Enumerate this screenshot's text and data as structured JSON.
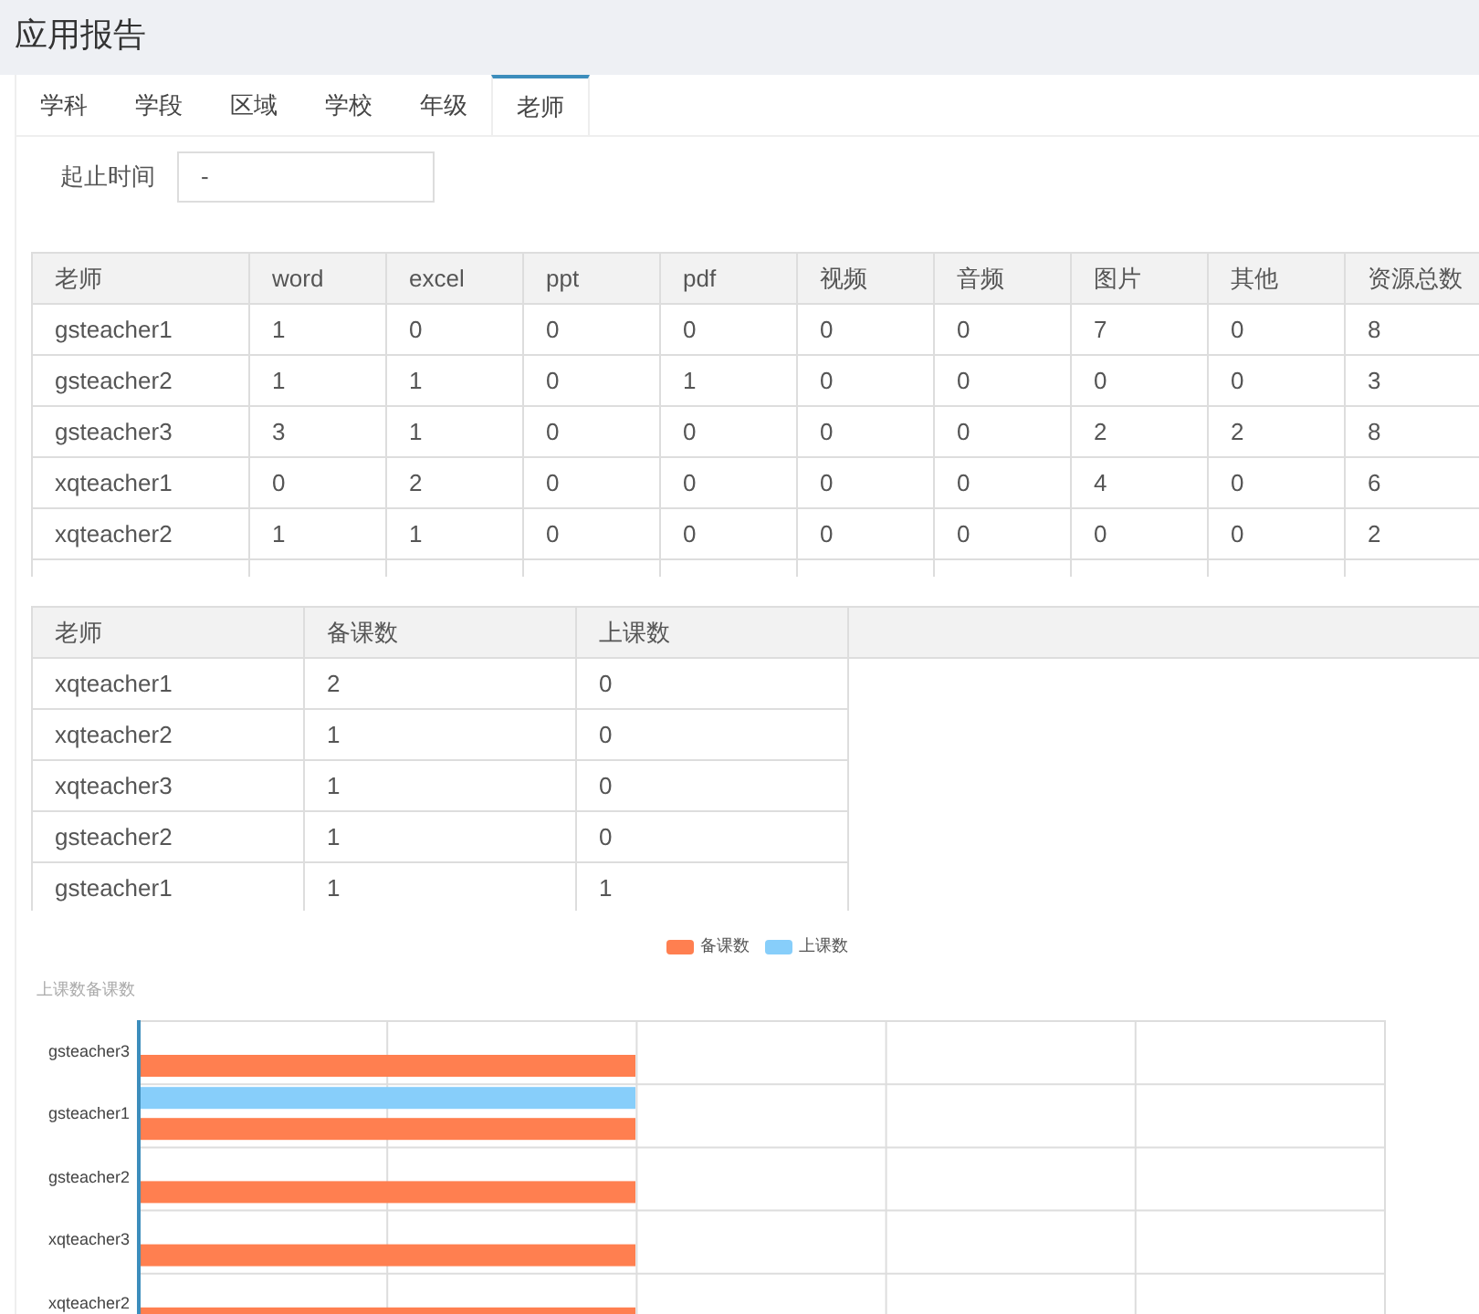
{
  "title": "应用报告",
  "tabs": [
    {
      "label": "学科",
      "selected": false
    },
    {
      "label": "学段",
      "selected": false
    },
    {
      "label": "区域",
      "selected": false
    },
    {
      "label": "学校",
      "selected": false
    },
    {
      "label": "年级",
      "selected": false
    },
    {
      "label": "老师",
      "selected": true
    }
  ],
  "filter": {
    "label": "起止时间",
    "value": "-"
  },
  "resource_table": {
    "columns": [
      "老师",
      "word",
      "excel",
      "ppt",
      "pdf",
      "视频",
      "音频",
      "图片",
      "其他",
      "资源总数"
    ],
    "rows": [
      [
        "gsteacher1",
        "1",
        "0",
        "0",
        "0",
        "0",
        "0",
        "7",
        "0",
        "8"
      ],
      [
        "gsteacher2",
        "1",
        "1",
        "0",
        "1",
        "0",
        "0",
        "0",
        "0",
        "3"
      ],
      [
        "gsteacher3",
        "3",
        "1",
        "0",
        "0",
        "0",
        "0",
        "2",
        "2",
        "8"
      ],
      [
        "xqteacher1",
        "0",
        "2",
        "0",
        "0",
        "0",
        "0",
        "4",
        "0",
        "6"
      ],
      [
        "xqteacher2",
        "1",
        "1",
        "0",
        "0",
        "0",
        "0",
        "0",
        "0",
        "2"
      ]
    ]
  },
  "lesson_table": {
    "columns": [
      "老师",
      "备课数",
      "上课数"
    ],
    "rows": [
      [
        "xqteacher1",
        "2",
        "0"
      ],
      [
        "xqteacher2",
        "1",
        "0"
      ],
      [
        "xqteacher3",
        "1",
        "0"
      ],
      [
        "gsteacher2",
        "1",
        "0"
      ],
      [
        "gsteacher1",
        "1",
        "1"
      ]
    ]
  },
  "chart": {
    "legend": [
      {
        "label": "备课数",
        "color": "#ff7f50"
      },
      {
        "label": "上课数",
        "color": "#87cefa"
      }
    ],
    "title": "上课数备课数",
    "categories": [
      "gsteacher3",
      "gsteacher1",
      "gsteacher2",
      "xqteacher3",
      "xqteacher2"
    ]
  }
}
